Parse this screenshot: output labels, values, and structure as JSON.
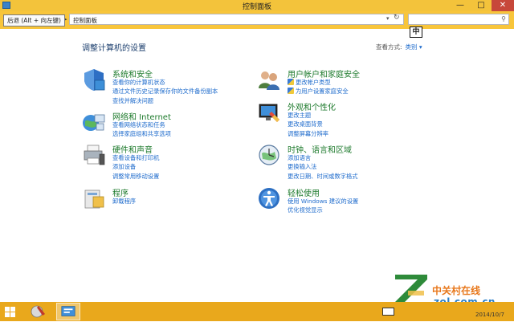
{
  "window": {
    "title": "控制面板",
    "min_glyph": "—",
    "max_glyph": "□",
    "close_glyph": "✕"
  },
  "navbar": {
    "tooltip": "后退 (Alt + 向左键)",
    "breadcrumb": "控制面板",
    "search_placeholder": ""
  },
  "ime": {
    "label": "中"
  },
  "main": {
    "title": "调整计算机的设置",
    "view_by_label": "查看方式:",
    "view_by_value": "类别 ▾"
  },
  "categories": [
    {
      "name": "系统和安全",
      "icon": "shield-icon",
      "links": [
        "查看你的计算机状态",
        "通过文件历史记录保存你的文件备份副本",
        "查找并解决问题"
      ]
    },
    {
      "name": "网络和 Internet",
      "icon": "network-icon",
      "links": [
        "查看网络状态和任务",
        "选择家庭组和共享选项"
      ]
    },
    {
      "name": "硬件和声音",
      "icon": "printer-icon",
      "links": [
        "查看设备和打印机",
        "添加设备",
        "调整常用移动设置"
      ]
    },
    {
      "name": "程序",
      "icon": "programs-icon",
      "links": [
        "卸载程序"
      ]
    },
    {
      "name": "用户帐户和家庭安全",
      "icon": "users-icon",
      "links": [
        "更改帐户类型",
        "为用户设置家庭安全"
      ]
    },
    {
      "name": "外观和个性化",
      "icon": "appearance-icon",
      "links": [
        "更改主题",
        "更改桌面背景",
        "调整屏幕分辨率"
      ]
    },
    {
      "name": "时钟、语言和区域",
      "icon": "clock-globe-icon",
      "links": [
        "添加语言",
        "更换输入法",
        "更改日期、时间或数字格式"
      ]
    },
    {
      "name": "轻松使用",
      "icon": "ease-of-access-icon",
      "links": [
        "使用 Windows 建议的设置",
        "优化视觉显示"
      ]
    }
  ],
  "watermark": {
    "line1": "中关村在线",
    "line2": "zol.com.cn"
  },
  "taskbar": {
    "clock_date": "2014/10/7"
  },
  "colors": {
    "titlebar": "#f3c33b",
    "taskbar": "#e9a81c",
    "link": "#1e6bcc",
    "heading": "#1d7a2c"
  }
}
